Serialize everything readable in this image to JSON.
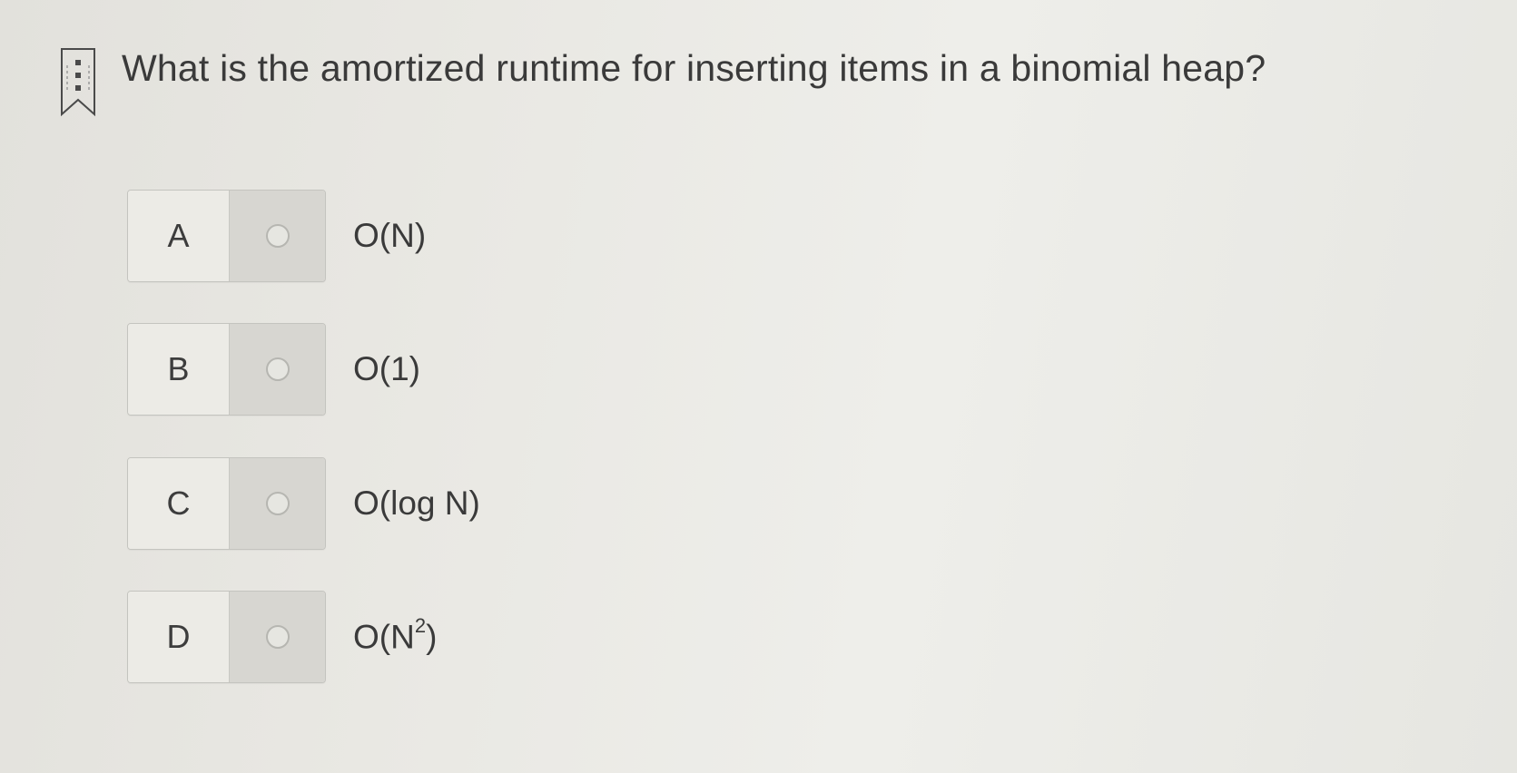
{
  "question": {
    "text": "What is the amortized runtime for inserting items in a binomial heap?",
    "bookmark_icon": "bookmark-icon"
  },
  "options": [
    {
      "letter": "A",
      "text": "O(N)",
      "selected": false
    },
    {
      "letter": "B",
      "text": "O(1)",
      "selected": false
    },
    {
      "letter": "C",
      "text": "O(log N)",
      "selected": false
    },
    {
      "letter": "D",
      "text_base": "O(N",
      "text_sup": "2",
      "text_end": ")",
      "selected": false
    }
  ]
}
